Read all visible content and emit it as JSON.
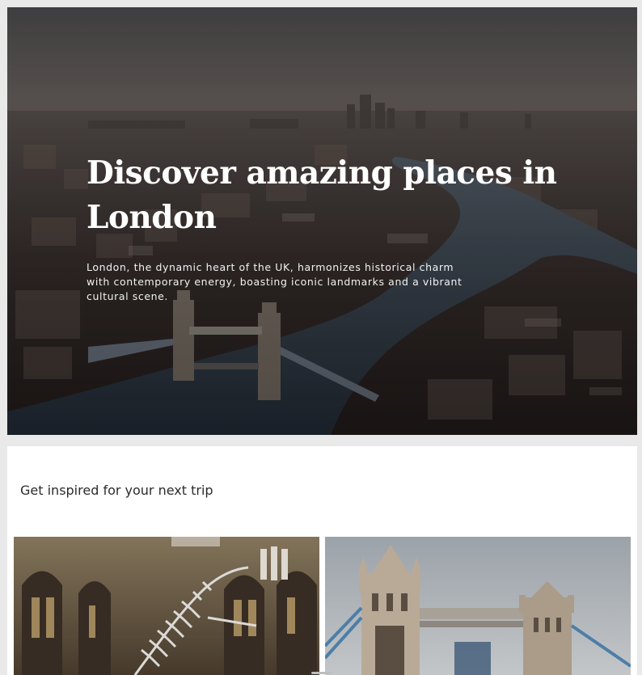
{
  "hero": {
    "title": "Discover amazing places in London",
    "description": "London, the dynamic heart of the UK, harmonizes historical charm with contemporary energy, boasting iconic landmarks and a vibrant cultural scene.",
    "image": "aerial-london-thames-tower-bridge"
  },
  "inspiration": {
    "heading": "Get inspired for your next trip",
    "cards": [
      {
        "image": "natural-history-museum-whale-skeleton"
      },
      {
        "image": "tower-bridge"
      }
    ]
  }
}
